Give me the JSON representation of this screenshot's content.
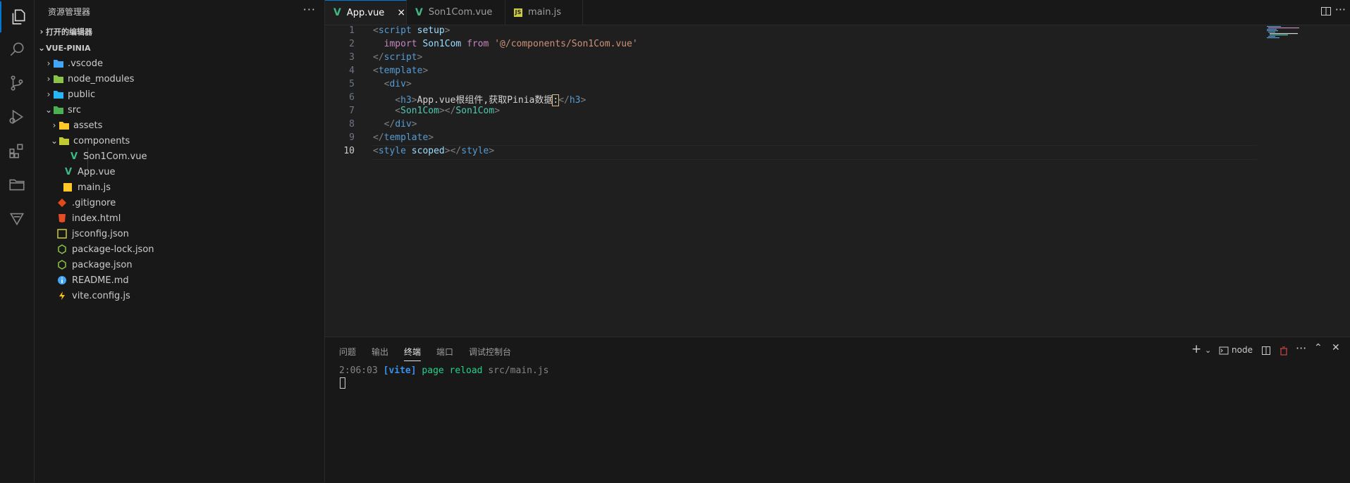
{
  "sidebar": {
    "title": "资源管理器",
    "more": "···",
    "open_editors": "打开的编辑器",
    "project": "VUE-PINIA",
    "items": [
      {
        "label": ".vscode"
      },
      {
        "label": "node_modules"
      },
      {
        "label": "public"
      },
      {
        "label": "src"
      },
      {
        "label": "assets"
      },
      {
        "label": "components"
      },
      {
        "label": "Son1Com.vue"
      },
      {
        "label": "App.vue"
      },
      {
        "label": "main.js"
      },
      {
        "label": ".gitignore"
      },
      {
        "label": "index.html"
      },
      {
        "label": "jsconfig.json"
      },
      {
        "label": "package-lock.json"
      },
      {
        "label": "package.json"
      },
      {
        "label": "README.md"
      },
      {
        "label": "vite.config.js"
      }
    ]
  },
  "tabs": [
    {
      "label": "App.vue",
      "icon": "V",
      "close": "×"
    },
    {
      "label": "Son1Com.vue",
      "icon": "V"
    },
    {
      "label": "main.js",
      "icon": "JS"
    }
  ],
  "editor": {
    "line_numbers": [
      "1",
      "2",
      "3",
      "4",
      "5",
      "6",
      "7",
      "8",
      "9",
      "10"
    ],
    "lines": {
      "l1a": "<",
      "l1b": "script",
      "l1c": " setup",
      "l1d": ">",
      "l2a": "  import",
      "l2b": " Son1Com",
      "l2c": " from",
      "l2d": " '@/components/Son1Com.vue'",
      "l3a": "</",
      "l3b": "script",
      "l3c": ">",
      "l4a": "<",
      "l4b": "template",
      "l4c": ">",
      "l5a": "  <",
      "l5b": "div",
      "l5c": ">",
      "l6a": "    <",
      "l6b": "h3",
      "l6c": ">",
      "l6d": "App.vue根组件,获取Pinia数据",
      "l6e": ":",
      "l6f": "</",
      "l6g": "h3",
      "l6h": ">",
      "l7a": "    <",
      "l7b": "Son1Com",
      "l7c": "></",
      "l7d": "Son1Com",
      "l7e": ">",
      "l8a": "  </",
      "l8b": "div",
      "l8c": ">",
      "l9a": "</",
      "l9b": "template",
      "l9c": ">",
      "l10a": "<",
      "l10b": "style",
      "l10c": " scoped",
      "l10d": "></",
      "l10e": "style",
      "l10f": ">"
    }
  },
  "panel": {
    "tabs": [
      "问题",
      "输出",
      "终端",
      "端口",
      "调试控制台"
    ],
    "terminal_name": "node",
    "terminal": {
      "time": "2:06:03 ",
      "tag": "[vite]",
      "msg": " page reload",
      "file": " src/main.js"
    }
  },
  "colors": {
    "accent": "#0078d4",
    "vue_green": "#41b883",
    "js_yellow": "#cbcb41"
  }
}
